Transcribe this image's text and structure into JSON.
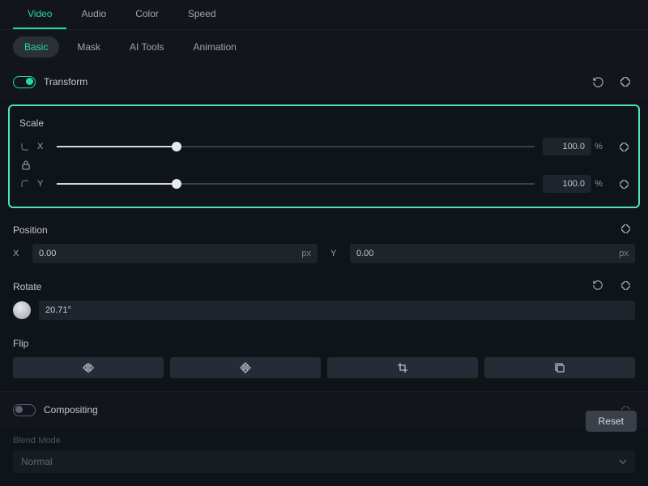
{
  "tabs": {
    "video": "Video",
    "audio": "Audio",
    "color": "Color",
    "speed": "Speed"
  },
  "subtabs": {
    "basic": "Basic",
    "mask": "Mask",
    "aitools": "AI Tools",
    "animation": "Animation"
  },
  "transform": {
    "label": "Transform",
    "scale": {
      "label": "Scale",
      "x_label": "X",
      "y_label": "Y",
      "x_val": "100.0",
      "y_val": "100.0",
      "unit": "%",
      "pct": 25
    },
    "position": {
      "label": "Position",
      "x_label": "X",
      "y_label": "Y",
      "x_val": "0.00",
      "y_val": "0.00",
      "unit": "px"
    },
    "rotate": {
      "label": "Rotate",
      "val": "20.71°"
    },
    "flip": {
      "label": "Flip"
    }
  },
  "compositing": {
    "label": "Compositing",
    "blend_label": "Blend Mode",
    "blend_val": "Normal"
  },
  "reset": "Reset"
}
